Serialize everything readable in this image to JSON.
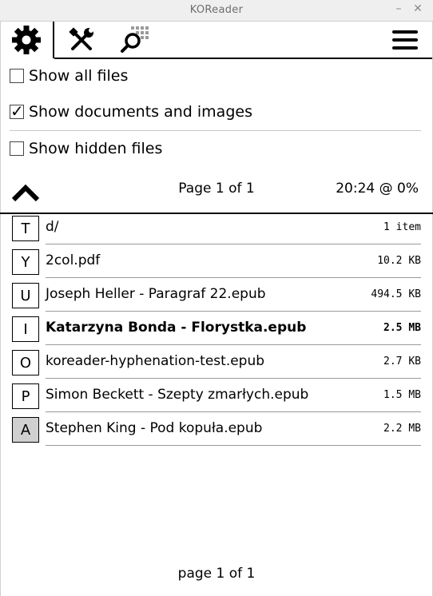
{
  "window": {
    "title": "KOReader",
    "minimize": "–",
    "close": "✕"
  },
  "tabs": [
    {
      "icon": "gear-icon",
      "active": true
    },
    {
      "icon": "tools-icon",
      "active": false
    },
    {
      "icon": "search-icon",
      "active": false
    }
  ],
  "menu": {
    "icon": "hamburger-menu-icon",
    "items": [
      {
        "label": "Show all files",
        "checked": false
      },
      {
        "label": "Show documents and images",
        "checked": true
      },
      {
        "label": "Show hidden files",
        "checked": false
      }
    ]
  },
  "menu_footer": {
    "page_label": "Page 1 of 1",
    "status": "20:24 @ 0%"
  },
  "files": [
    {
      "key": "T",
      "name": "d/",
      "size": "1 item",
      "bold": false,
      "selected": false
    },
    {
      "key": "Y",
      "name": "2col.pdf",
      "size": "10.2 KB",
      "bold": false,
      "selected": false
    },
    {
      "key": "U",
      "name": "Joseph Heller - Paragraf 22.epub",
      "size": "494.5 KB",
      "bold": false,
      "selected": false
    },
    {
      "key": "I",
      "name": "Katarzyna Bonda - Florystka.epub",
      "size": "2.5 MB",
      "bold": true,
      "selected": false
    },
    {
      "key": "O",
      "name": "koreader-hyphenation-test.epub",
      "size": "2.7 KB",
      "bold": false,
      "selected": false
    },
    {
      "key": "P",
      "name": "Simon Beckett - Szepty zmarłych.epub",
      "size": "1.5 MB",
      "bold": false,
      "selected": false
    },
    {
      "key": "A",
      "name": "Stephen King - Pod kopuła.epub",
      "size": "2.2 MB",
      "bold": false,
      "selected": true
    }
  ],
  "pagination": {
    "label": "page 1 of 1"
  }
}
